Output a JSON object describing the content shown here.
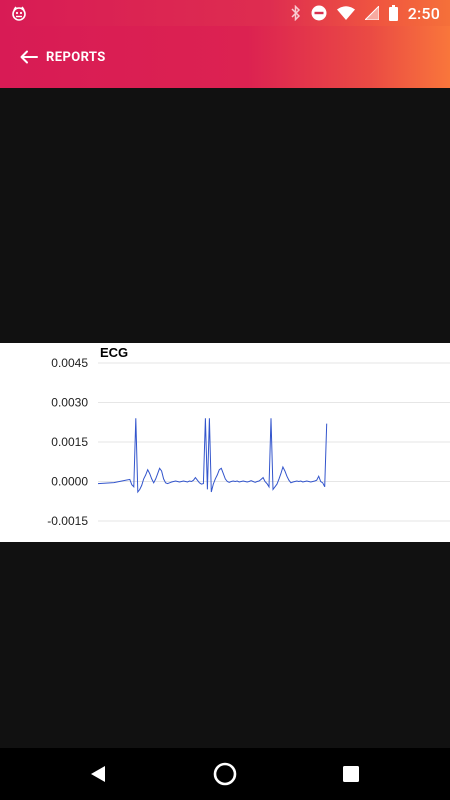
{
  "status_bar": {
    "time": "2:50",
    "left_icon": "app-notification-icon",
    "icons": [
      "bluetooth-icon",
      "do-not-disturb-icon",
      "wifi-icon",
      "cell-signal-icon",
      "battery-icon"
    ]
  },
  "app_bar": {
    "back_icon": "arrow-back-icon",
    "title": "REPORTS",
    "gradient": [
      "#d81b55",
      "#f9763b"
    ]
  },
  "chart_data": {
    "type": "line",
    "title": "ECG",
    "xlabel": "",
    "ylabel": "",
    "ylim": [
      -0.0015,
      0.0045
    ],
    "yticks": [
      "0.0045",
      "0.0030",
      "0.0015",
      "0.0000",
      "-0.0015"
    ],
    "ytick_values": [
      0.0045,
      0.003,
      0.0015,
      0.0,
      -0.0015
    ],
    "grid": true,
    "line_color": "#3355cc",
    "x": [
      0,
      8,
      16,
      24,
      32,
      34,
      36,
      38,
      40,
      42,
      44,
      46,
      48,
      50,
      52,
      54,
      56,
      58,
      60,
      62,
      64,
      66,
      68,
      70,
      72,
      74,
      76,
      78,
      80,
      82,
      84,
      86,
      88,
      90,
      92,
      94,
      96,
      98,
      100,
      102,
      104,
      106,
      108,
      110,
      112,
      114,
      116,
      118,
      120,
      122,
      124,
      126,
      128,
      130,
      132,
      134,
      136,
      138,
      140,
      142,
      144,
      146,
      148,
      150,
      152,
      154,
      156,
      158,
      160,
      162,
      164,
      166,
      168,
      170,
      172,
      174,
      176,
      178,
      180,
      182,
      184,
      186,
      188,
      190,
      192,
      194,
      196,
      198,
      200,
      202,
      204,
      206,
      208,
      210,
      212,
      214,
      216,
      218,
      220,
      222,
      224,
      226,
      228,
      230,
      232,
      234,
      236,
      238,
      240,
      242,
      244,
      246,
      248,
      250,
      252,
      254,
      256,
      258,
      260,
      262,
      264,
      266,
      268,
      270,
      272,
      274,
      276,
      278,
      280,
      282,
      284,
      286,
      288,
      290,
      292,
      294,
      296,
      298,
      300,
      302,
      304,
      306,
      308,
      310,
      312,
      314,
      316,
      318,
      320,
      322,
      324,
      326,
      328,
      330,
      332,
      334,
      336,
      338,
      340,
      342,
      344,
      346,
      348,
      350
    ],
    "y": [
      -8e-05,
      -6e-05,
      -4e-05,
      2e-05,
      8e-05,
      -0.00012,
      -0.0002,
      0.0024,
      -0.0004,
      -0.0003,
      -0.00015,
      0.0001,
      0.00025,
      0.00045,
      0.0003,
      0.0001,
      -5e-05,
      0.0001,
      0.0003,
      0.0005,
      0.0004,
      0.0001,
      -5e-05,
      -8e-05,
      -5e-05,
      -2e-05,
      0.0,
      2e-05,
      0.0,
      -2e-05,
      0.0,
      2e-05,
      0.0,
      -2e-05,
      2e-05,
      0.0,
      5e-05,
      0.00015,
      5e-05,
      -5e-05,
      -0.0001,
      -8e-05,
      0.0024,
      -0.0003,
      0.0024,
      -0.0004,
      -0.0001,
      0.0001,
      0.00025,
      0.00045,
      0.0005,
      0.0003,
      0.0001,
      0.0,
      -3e-05,
      0.0,
      2e-05,
      0.0,
      2e-05,
      -2e-05,
      0.0,
      2e-05,
      0.0,
      -2e-05,
      0.0,
      3e-05,
      0.0,
      -3e-05,
      0.0,
      2e-05,
      8e-05,
      0.00015,
      0.0,
      -8e-05,
      -0.0002,
      0.0024,
      -0.0003,
      -0.0002,
      -0.0001,
      0.0001,
      0.0003,
      0.00055,
      0.0004,
      0.0002,
      5e-05,
      -5e-05,
      -2e-05,
      0.0,
      2e-05,
      0.0,
      2e-05,
      -2e-05,
      0.0,
      2e-05,
      0.0,
      -2e-05,
      0.0,
      2e-05,
      5e-05,
      0.0002,
      0.0,
      -5e-05,
      -0.0002,
      0.0022
    ]
  },
  "nav_bar": {
    "buttons": [
      "back-triangle-icon",
      "home-circle-icon",
      "recents-square-icon"
    ]
  }
}
